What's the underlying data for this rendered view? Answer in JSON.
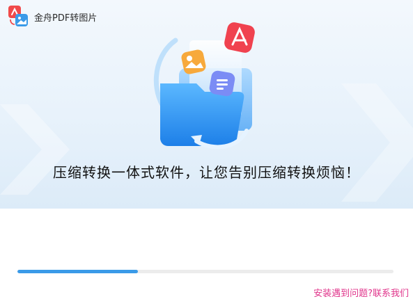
{
  "window": {
    "title": "金舟PDF转图片"
  },
  "icons": {
    "app_logo": "pdf-to-image-logo-icon",
    "illustration": "folder-with-files-illustration"
  },
  "hero": {
    "headline": "压缩转换一体式软件，让您告别压缩转换烦恼！"
  },
  "progress": {
    "fraction": 0.32
  },
  "footer": {
    "help_link": "安装遇到问题?联系我们"
  },
  "colors": {
    "accent": "#3a9ae8",
    "link": "#e0348b",
    "hero_bg": "#e8f2fb"
  }
}
